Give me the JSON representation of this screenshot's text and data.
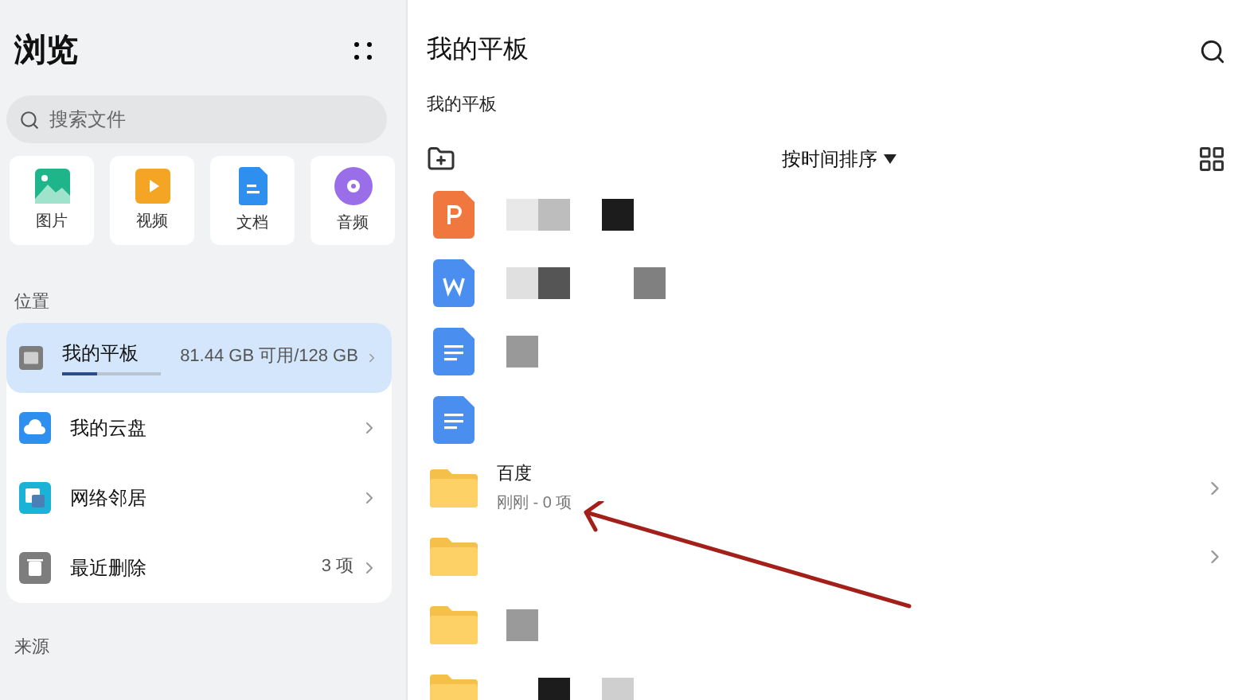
{
  "sidebar": {
    "title": "浏览",
    "search": {
      "placeholder": "搜索文件"
    },
    "categories": [
      {
        "kind": "image",
        "label": "图片"
      },
      {
        "kind": "video",
        "label": "视频"
      },
      {
        "kind": "doc",
        "label": "文档"
      },
      {
        "kind": "audio",
        "label": "音频"
      }
    ],
    "locations_heading": "位置",
    "locations": [
      {
        "kind": "tablet",
        "label": "我的平板",
        "detail": "81.44 GB 可用/128 GB",
        "level": 0.36,
        "selected": true
      },
      {
        "kind": "cloud",
        "label": "我的云盘",
        "selected": false
      },
      {
        "kind": "network",
        "label": "网络邻居",
        "selected": false
      },
      {
        "kind": "trash",
        "label": "最近删除",
        "detail": "3 项",
        "selected": false
      }
    ],
    "sources_heading": "来源"
  },
  "main": {
    "title": "我的平板",
    "breadcrumb": "我的平板",
    "sort": "按时间排序",
    "files": [
      {
        "kind": "ppt",
        "chevron": false
      },
      {
        "kind": "word",
        "chevron": false
      },
      {
        "kind": "doc",
        "chevron": false
      },
      {
        "kind": "doc",
        "chevron": false
      },
      {
        "kind": "folder",
        "name": "百度",
        "meta": "刚刚 - 0 项",
        "chevron": true
      },
      {
        "kind": "folder",
        "chevron": true
      },
      {
        "kind": "folder",
        "chevron": false
      },
      {
        "kind": "folder",
        "chevron": false
      }
    ]
  }
}
